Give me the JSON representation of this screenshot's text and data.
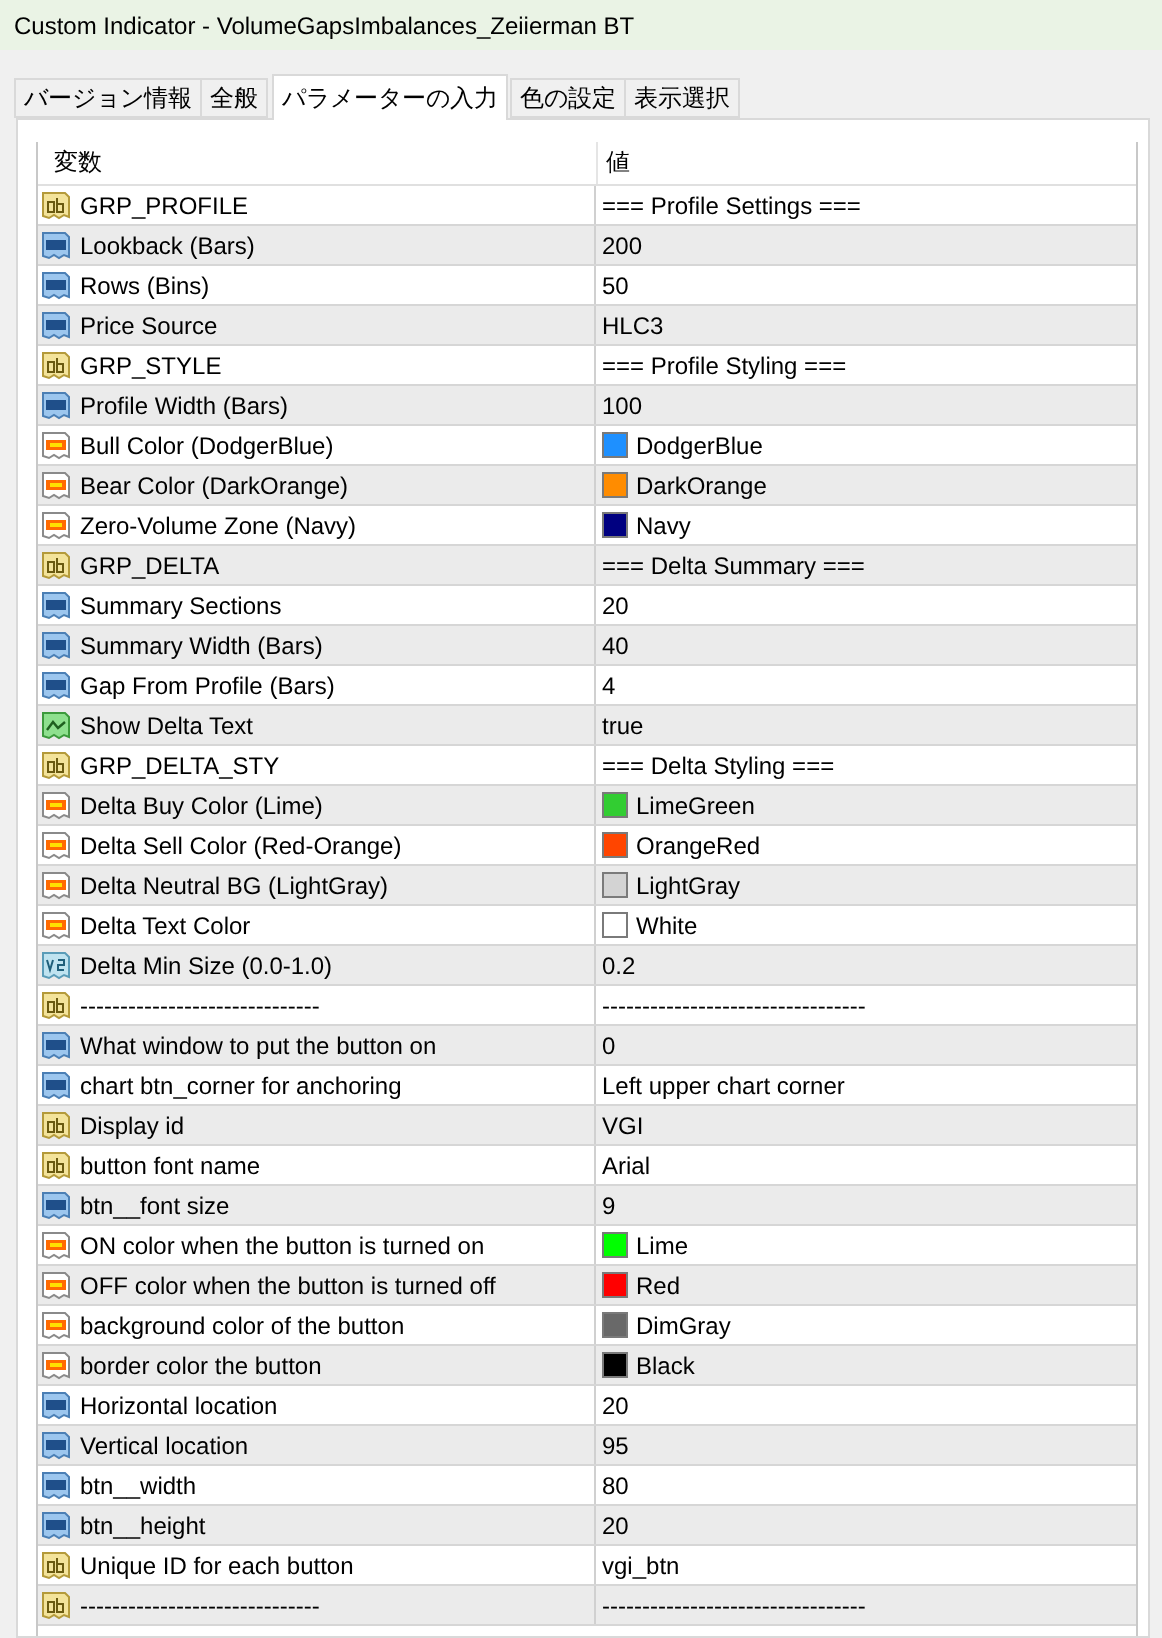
{
  "window": {
    "title": "Custom Indicator - VolumeGapsImbalances_Zeiierman BT"
  },
  "tabs": [
    {
      "label": "バージョン情報",
      "selected": false
    },
    {
      "label": "全般",
      "selected": false
    },
    {
      "label": "パラメーターの入力",
      "selected": true
    },
    {
      "label": "色の設定",
      "selected": false
    },
    {
      "label": "表示選択",
      "selected": false
    }
  ],
  "table": {
    "columns": [
      "変数",
      "値"
    ],
    "rows": [
      {
        "kind": "string",
        "name": "GRP_PROFILE",
        "value": "=== Profile Settings ==="
      },
      {
        "kind": "int",
        "name": "Lookback (Bars)",
        "value": "200"
      },
      {
        "kind": "int",
        "name": "Rows (Bins)",
        "value": "50"
      },
      {
        "kind": "int",
        "name": "Price Source",
        "value": "HLC3"
      },
      {
        "kind": "string",
        "name": "GRP_STYLE",
        "value": "=== Profile Styling ==="
      },
      {
        "kind": "int",
        "name": "Profile Width (Bars)",
        "value": "100"
      },
      {
        "kind": "color",
        "name": "Bull Color (DodgerBlue)",
        "value": "DodgerBlue",
        "color": "#1e90ff"
      },
      {
        "kind": "color",
        "name": "Bear Color (DarkOrange)",
        "value": "DarkOrange",
        "color": "#ff8c00"
      },
      {
        "kind": "color",
        "name": "Zero-Volume Zone (Navy)",
        "value": "Navy",
        "color": "#000080"
      },
      {
        "kind": "string",
        "name": "GRP_DELTA",
        "value": "=== Delta Summary ==="
      },
      {
        "kind": "int",
        "name": "Summary Sections",
        "value": "20"
      },
      {
        "kind": "int",
        "name": "Summary Width (Bars)",
        "value": "40"
      },
      {
        "kind": "int",
        "name": "Gap From Profile (Bars)",
        "value": "4"
      },
      {
        "kind": "bool",
        "name": "Show Delta Text",
        "value": "true"
      },
      {
        "kind": "string",
        "name": "GRP_DELTA_STY",
        "value": "=== Delta Styling ==="
      },
      {
        "kind": "color",
        "name": "Delta Buy Color (Lime)",
        "value": "LimeGreen",
        "color": "#32cd32"
      },
      {
        "kind": "color",
        "name": "Delta Sell Color (Red-Orange)",
        "value": "OrangeRed",
        "color": "#ff4500"
      },
      {
        "kind": "color",
        "name": "Delta Neutral BG (LightGray)",
        "value": "LightGray",
        "color": "#d3d3d3"
      },
      {
        "kind": "color",
        "name": "Delta Text Color",
        "value": "White",
        "color": "#ffffff"
      },
      {
        "kind": "double",
        "name": "Delta Min Size (0.0-1.0)",
        "value": "0.2"
      },
      {
        "kind": "string",
        "name": "------------------------------",
        "value": "---------------------------------"
      },
      {
        "kind": "int",
        "name": "What window to put the button on",
        "value": "0"
      },
      {
        "kind": "int",
        "name": "chart btn_corner for anchoring",
        "value": "Left upper chart corner"
      },
      {
        "kind": "string",
        "name": "Display id",
        "value": "VGI"
      },
      {
        "kind": "string",
        "name": "button font name",
        "value": "Arial"
      },
      {
        "kind": "int",
        "name": "btn__font size",
        "value": "9"
      },
      {
        "kind": "color",
        "name": "ON color when the button is turned on",
        "value": "Lime",
        "color": "#00ff00"
      },
      {
        "kind": "color",
        "name": "OFF color when the button is turned off",
        "value": "Red",
        "color": "#ff0000"
      },
      {
        "kind": "color",
        "name": "background color of the button",
        "value": "DimGray",
        "color": "#696969"
      },
      {
        "kind": "color",
        "name": "border color the button",
        "value": "Black",
        "color": "#000000"
      },
      {
        "kind": "int",
        "name": "Horizontal location",
        "value": "20"
      },
      {
        "kind": "int",
        "name": "Vertical location",
        "value": "95"
      },
      {
        "kind": "int",
        "name": "btn__width",
        "value": "80"
      },
      {
        "kind": "int",
        "name": "btn__height",
        "value": "20"
      },
      {
        "kind": "string",
        "name": "Unique ID for each button",
        "value": "vgi_btn"
      },
      {
        "kind": "string",
        "name": "------------------------------",
        "value": "---------------------------------"
      }
    ]
  }
}
